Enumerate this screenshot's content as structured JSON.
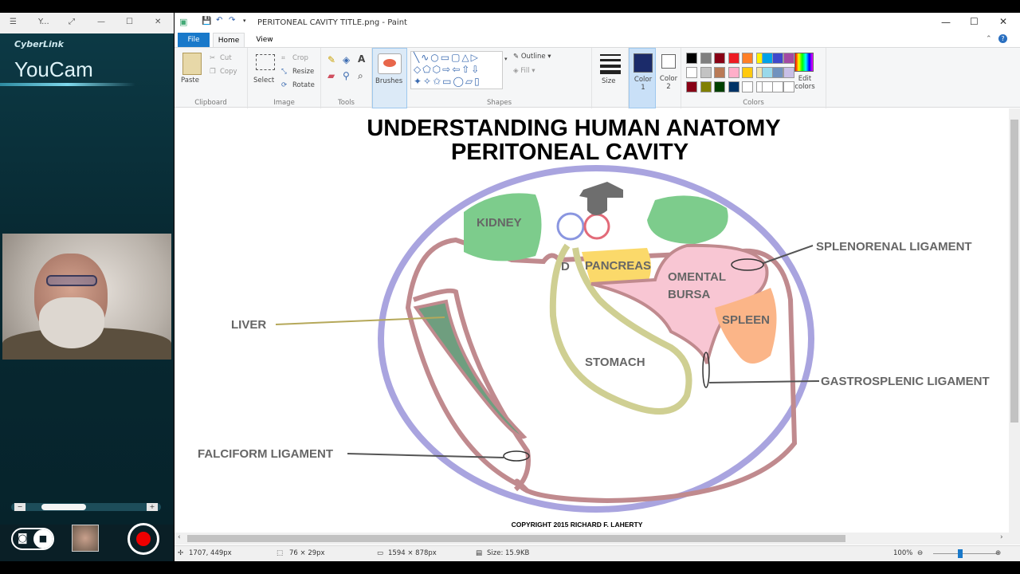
{
  "youcam": {
    "win_title": "Y...",
    "brand": "CyberLink",
    "app": "YouCam",
    "minus": "−",
    "plus": "+"
  },
  "paint": {
    "title": "PERITONEAL CAVITY TITLE.png - Paint",
    "tabs": {
      "file": "File",
      "home": "Home",
      "view": "View"
    },
    "clipboard": {
      "paste": "Paste",
      "cut": "Cut",
      "copy": "Copy",
      "label": "Clipboard"
    },
    "image": {
      "select": "Select",
      "crop": "Crop",
      "resize": "Resize",
      "rotate": "Rotate",
      "label": "Image"
    },
    "tools": {
      "label": "Tools"
    },
    "brushes": "Brushes",
    "shapes": {
      "outline": "Outline",
      "fill": "Fill",
      "label": "Shapes"
    },
    "size": "Size",
    "color1": "Color 1",
    "color2": "Color 2",
    "colors": {
      "label": "Colors",
      "edit": "Edit colors",
      "palette": [
        "#000000",
        "#7f7f7f",
        "#880015",
        "#ed1c24",
        "#ff7f27",
        "#fff200",
        "#22b14c",
        "#00a2e8",
        "#3f48cc",
        "#a349a4",
        "#ffffff",
        "#c3c3c3",
        "#b97a57",
        "#ffaec9",
        "#ffc90e",
        "#efe4b0",
        "#b5e61d",
        "#99d9ea",
        "#7092be",
        "#c8bfe7",
        "#880015",
        "#808000",
        "#004000",
        "#003366",
        "#ffffff",
        "#ffffff",
        "#ffffff",
        "#ffffff",
        "#ffffff",
        "#ffffff"
      ]
    },
    "status": {
      "pos": "1707, 449px",
      "sel": "76 × 29px",
      "dim": "1594 × 878px",
      "size": "Size: 15.9KB",
      "zoom": "100%"
    }
  },
  "drawing": {
    "title1": "UNDERSTANDING HUMAN ANATOMY",
    "title2": "PERITONEAL CAVITY",
    "labels": {
      "kidney": "KIDNEY",
      "d": "D",
      "pancreas": "PANCREAS",
      "omental1": "OMENTAL",
      "omental2": "BURSA",
      "spleen": "SPLEEN",
      "stomach": "STOMACH",
      "liver": "LIVER",
      "falciform": "FALCIFORM LIGAMENT",
      "splenorenal": "SPLENORENAL LIGAMENT",
      "gastrosplenic": "GASTROSPLENIC LIGAMENT"
    },
    "copyright": "COPYRIGHT 2015 RICHARD F. LAHERTY"
  }
}
